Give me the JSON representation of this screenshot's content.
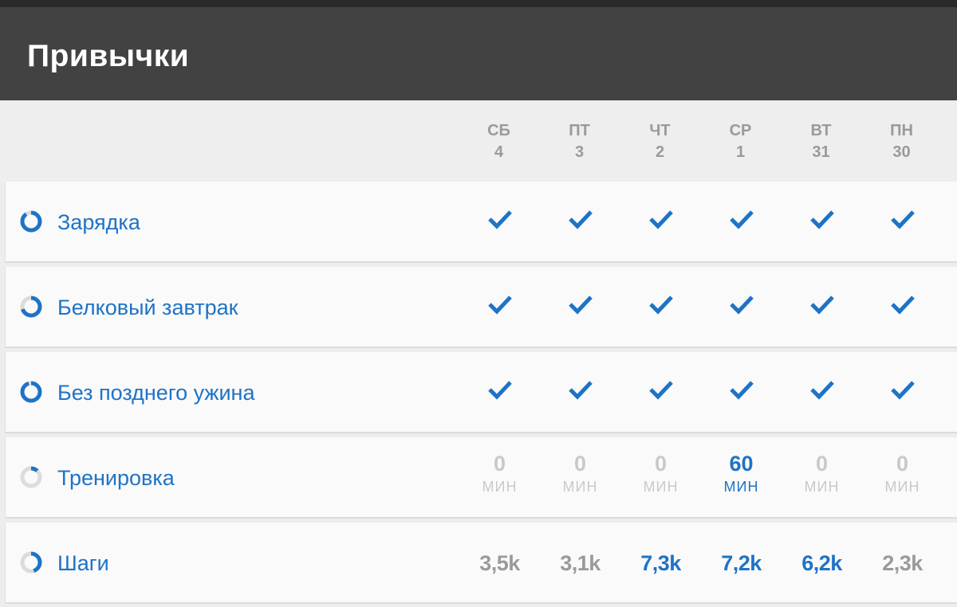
{
  "app": {
    "title": "Привычки"
  },
  "colors": {
    "appbar": "#424242",
    "accent": "#1e73c6",
    "muted": "#c9c9c9",
    "grey": "#9a9a9a",
    "ring_track": "#dcdcdc"
  },
  "days": [
    {
      "name": "СБ",
      "num": "4"
    },
    {
      "name": "ПТ",
      "num": "3"
    },
    {
      "name": "ЧТ",
      "num": "2"
    },
    {
      "name": "СР",
      "num": "1"
    },
    {
      "name": "ВТ",
      "num": "31"
    },
    {
      "name": "ПН",
      "num": "30"
    }
  ],
  "habits": [
    {
      "name": "Зарядка",
      "type": "check",
      "score": 0.9,
      "entries": [
        {
          "done": true,
          "icon": "check-icon"
        },
        {
          "done": true,
          "icon": "check-icon"
        },
        {
          "done": true,
          "icon": "check-icon"
        },
        {
          "done": true,
          "icon": "check-icon"
        },
        {
          "done": true,
          "icon": "check-icon"
        },
        {
          "done": true,
          "icon": "check-icon"
        }
      ]
    },
    {
      "name": "Белковый завтрак",
      "type": "check",
      "score": 0.7,
      "entries": [
        {
          "done": true,
          "icon": "check-icon"
        },
        {
          "done": true,
          "icon": "check-icon"
        },
        {
          "done": true,
          "icon": "check-icon"
        },
        {
          "done": true,
          "icon": "check-icon"
        },
        {
          "done": true,
          "icon": "check-icon"
        },
        {
          "done": true,
          "icon": "check-icon"
        }
      ]
    },
    {
      "name": "Без позднего ужина",
      "type": "check",
      "score": 0.95,
      "entries": [
        {
          "done": true,
          "icon": "check-icon"
        },
        {
          "done": true,
          "icon": "check-icon"
        },
        {
          "done": true,
          "icon": "check-icon"
        },
        {
          "done": true,
          "icon": "check-icon"
        },
        {
          "done": true,
          "icon": "check-icon"
        },
        {
          "done": true,
          "icon": "check-icon"
        }
      ]
    },
    {
      "name": "Тренировка",
      "type": "minutes",
      "score": 0.12,
      "entries": [
        {
          "value": "0",
          "unit": "МИН",
          "active": false
        },
        {
          "value": "0",
          "unit": "МИН",
          "active": false
        },
        {
          "value": "0",
          "unit": "МИН",
          "active": false
        },
        {
          "value": "60",
          "unit": "МИН",
          "active": true
        },
        {
          "value": "0",
          "unit": "МИН",
          "active": false
        },
        {
          "value": "0",
          "unit": "МИН",
          "active": false
        }
      ]
    },
    {
      "name": "Шаги",
      "type": "steps",
      "score": 0.45,
      "entries": [
        {
          "value": "3,5k",
          "active": false
        },
        {
          "value": "3,1k",
          "active": false
        },
        {
          "value": "7,3k",
          "active": true
        },
        {
          "value": "7,2k",
          "active": true
        },
        {
          "value": "6,2k",
          "active": true
        },
        {
          "value": "2,3k",
          "active": false
        }
      ]
    }
  ]
}
